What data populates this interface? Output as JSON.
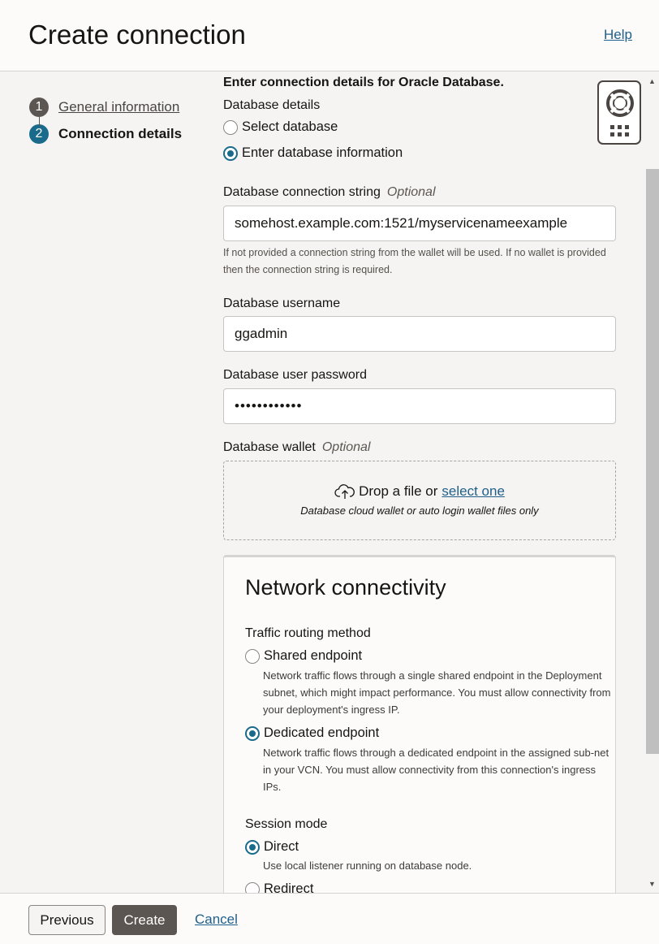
{
  "header": {
    "title": "Create connection",
    "help_label": "Help"
  },
  "steps": [
    {
      "number": "1",
      "label": "General information"
    },
    {
      "number": "2",
      "label": "Connection details"
    }
  ],
  "form": {
    "section_title": "Enter connection details for Oracle Database.",
    "database_details_label": "Database details",
    "db_options": [
      "Select database",
      "Enter database information"
    ],
    "db_selected": "Enter database information",
    "conn_string": {
      "label": "Database connection string",
      "optional": "Optional",
      "value": "somehost.example.com:1521/myservicenameexample",
      "hint": "If not provided a connection string from the wallet will be used. If no wallet is provided then the connection string is required."
    },
    "username": {
      "label": "Database username",
      "value": "ggadmin"
    },
    "password": {
      "label": "Database user password",
      "value": "••••••••••••"
    },
    "wallet": {
      "label": "Database wallet",
      "optional": "Optional",
      "drop_text": "Drop a file or",
      "select_link": "select one",
      "hint": "Database cloud wallet or auto login wallet files only"
    }
  },
  "network": {
    "title": "Network connectivity",
    "routing_label": "Traffic routing method",
    "shared_label": "Shared endpoint",
    "shared_desc": "Network traffic flows through a single shared endpoint in the Deployment subnet, which might impact performance. You must allow connectivity from your deployment's ingress IP.",
    "dedicated_label": "Dedicated endpoint",
    "dedicated_desc": "Network traffic flows through a dedicated endpoint in the assigned sub-net in your VCN. You must allow connectivity from this connection's ingress IPs.",
    "routing_selected": "Dedicated endpoint",
    "session_label": "Session mode",
    "direct_label": "Direct",
    "direct_desc": "Use local listener running on database node.",
    "redirect_label": "Redirect",
    "session_selected": "Direct"
  },
  "footer": {
    "previous": "Previous",
    "create": "Create",
    "cancel": "Cancel"
  },
  "colors": {
    "accent": "#1a6a8c",
    "link": "#1f5f8a",
    "primary_button": "#5c5652"
  }
}
